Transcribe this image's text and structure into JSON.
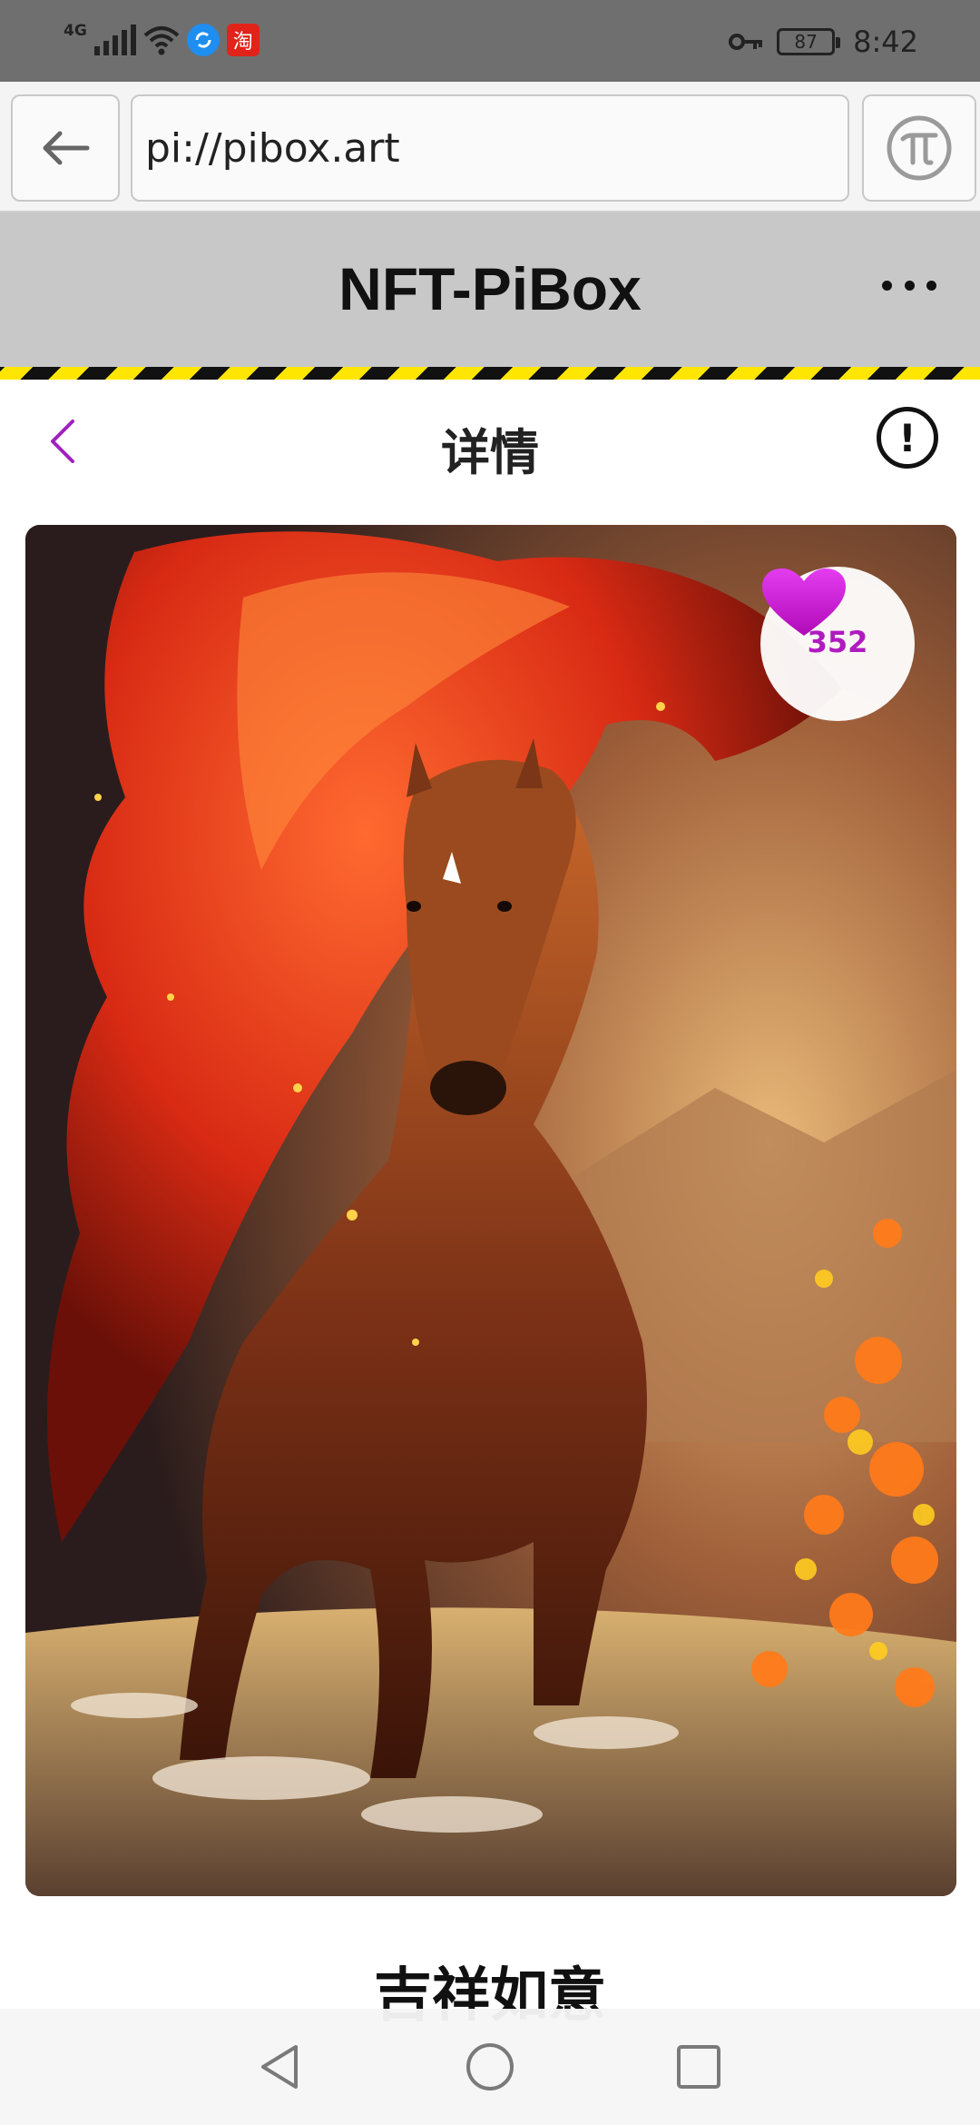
{
  "status_bar": {
    "network_type": "4G",
    "battery_level": "87",
    "time": "8:42",
    "icons": [
      "signal-icon",
      "wifi-icon",
      "app-notification-icon",
      "taobao-icon",
      "key-icon",
      "battery-icon"
    ],
    "app_badge_text": "淘"
  },
  "browser": {
    "url": "pi://pibox.art",
    "icons": [
      "back-arrow-icon",
      "pi-logo-icon"
    ]
  },
  "site_header": {
    "title": "NFT-PiBox",
    "icons": [
      "more-icon"
    ]
  },
  "page": {
    "title": "详情",
    "icons": [
      "chevron-left-icon",
      "info-icon"
    ]
  },
  "artwork": {
    "subject": "fiery red horse artwork",
    "like_count": "352",
    "icons": [
      "heart-icon"
    ]
  },
  "nft": {
    "name": "吉祥如意"
  },
  "system_nav": {
    "icons": [
      "nav-back-icon",
      "nav-home-icon",
      "nav-recents-icon"
    ]
  },
  "colors": {
    "status_bar_bg": "#6f6f6f",
    "header_bg": "#c8c8c8",
    "hazard_yellow": "#ffe600",
    "accent_purple": "#a020c0",
    "heart_magenta": "#d81fd8"
  }
}
